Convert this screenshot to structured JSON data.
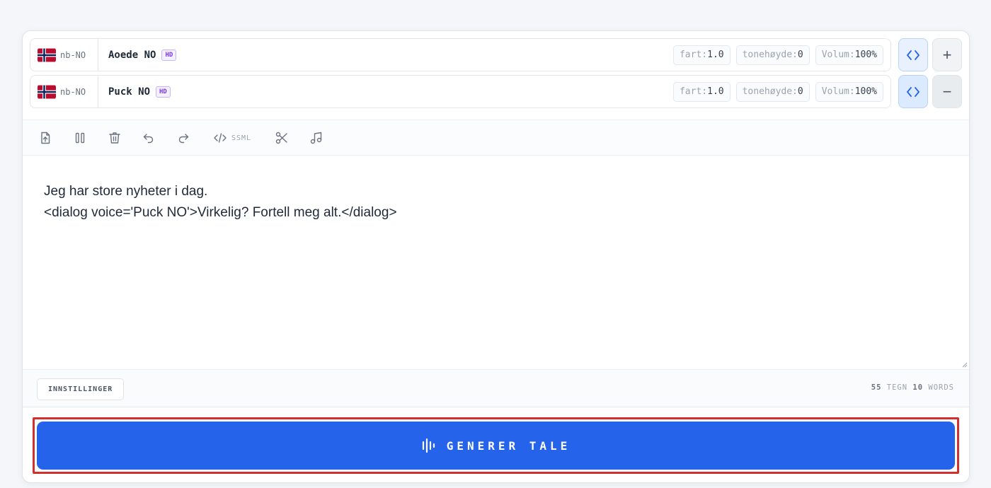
{
  "voices": [
    {
      "lang_code": "nb-NO",
      "flag_icon": "norway-flag-icon",
      "name": "Aoede NO",
      "badge": "HD",
      "params": [
        {
          "key": "fart:",
          "value": "1.0"
        },
        {
          "key": "tonehøyde:",
          "value": "0"
        },
        {
          "key": "Volum:",
          "value": "100%"
        }
      ],
      "action_icon": "plus-icon",
      "action_symbol": "+"
    },
    {
      "lang_code": "nb-NO",
      "flag_icon": "norway-flag-icon",
      "name": "Puck NO",
      "badge": "HD",
      "params": [
        {
          "key": "fart:",
          "value": "1.0"
        },
        {
          "key": "tonehøyde:",
          "value": "0"
        },
        {
          "key": "Volum:",
          "value": "100%"
        }
      ],
      "action_icon": "minus-icon",
      "action_symbol": "−"
    }
  ],
  "toolbar": {
    "ssml_label": "SSML",
    "icons": [
      "upload-icon",
      "pause-icon",
      "trash-icon",
      "undo-icon",
      "redo-icon",
      "code-icon",
      "scissors-icon",
      "music-note-icon"
    ]
  },
  "editor": {
    "lines": [
      "Jeg har store nyheter i dag.",
      "<dialog voice='Puck NO'>Virkelig? Fortell meg alt.</dialog>"
    ]
  },
  "footer": {
    "settings_label": "INNSTILLINGER",
    "char_count": "55",
    "char_unit": "TEGN",
    "word_count": "10",
    "word_unit": "WORDS"
  },
  "generate": {
    "label": "GENERER TALE",
    "icon": "audio-wave-icon"
  },
  "colors": {
    "accent": "#2563eb",
    "highlight_border": "#d32f2f",
    "badge_purple": "#7c3aed"
  }
}
